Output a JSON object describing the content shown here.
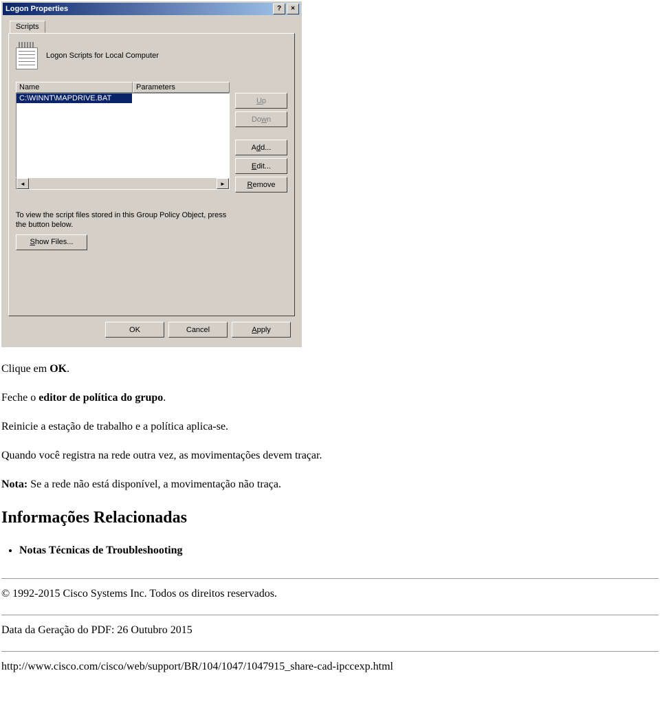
{
  "dialog": {
    "title": "Logon Properties",
    "help_btn": "?",
    "close_btn": "×",
    "tab_label": "Scripts",
    "header_label": "Logon Scripts for Local Computer",
    "columns": {
      "name": "Name",
      "parameters": "Parameters"
    },
    "rows": [
      {
        "name": "C:\\WINNT\\MAPDRIVE.BAT",
        "parameters": ""
      }
    ],
    "buttons": {
      "up": "Up",
      "down": "Down",
      "add": "Add...",
      "edit": "Edit...",
      "remove": "Remove"
    },
    "info_text_1": "To view the script files stored in this Group Policy Object, press",
    "info_text_2": "the button below.",
    "show_files": "Show Files...",
    "footer": {
      "ok": "OK",
      "cancel": "Cancel",
      "apply": "Apply"
    },
    "scroll_left": "◄",
    "scroll_right": "►"
  },
  "doc": {
    "p1a": "Clique em ",
    "p1b": "OK",
    "p1c": ".",
    "p2a": "Feche o ",
    "p2b": "editor de política do grupo",
    "p2c": ".",
    "p3": "Reinicie a estação de trabalho e a política aplica-se.",
    "p4": "Quando você registra na rede outra vez, as movimentações devem traçar.",
    "p5a": "Nota:",
    "p5b": " Se a rede não está disponível, a movimentação não traça.",
    "h2": "Informações Relacionadas",
    "li1": "Notas Técnicas de Troubleshooting",
    "copyright": "© 1992-2015 Cisco Systems Inc. Todos os direitos reservados.",
    "gen_date": "Data da Geração do PDF: 26 Outubro 2015",
    "url": "http://www.cisco.com/cisco/web/support/BR/104/1047/1047915_share-cad-ipccexp.html"
  }
}
